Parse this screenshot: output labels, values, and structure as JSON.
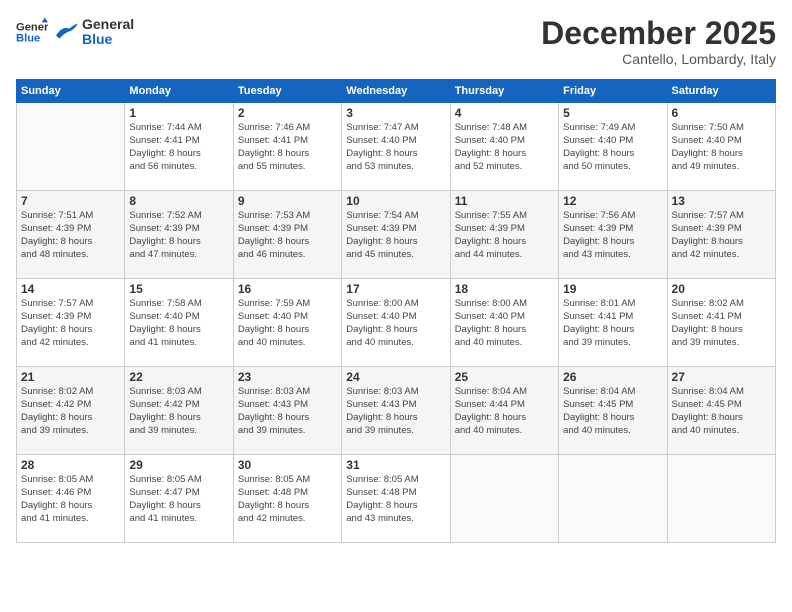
{
  "logo": {
    "general": "General",
    "blue": "Blue"
  },
  "header": {
    "month": "December 2025",
    "location": "Cantello, Lombardy, Italy"
  },
  "days_of_week": [
    "Sunday",
    "Monday",
    "Tuesday",
    "Wednesday",
    "Thursday",
    "Friday",
    "Saturday"
  ],
  "weeks": [
    [
      {
        "day": "",
        "info": ""
      },
      {
        "day": "1",
        "info": "Sunrise: 7:44 AM\nSunset: 4:41 PM\nDaylight: 8 hours\nand 56 minutes."
      },
      {
        "day": "2",
        "info": "Sunrise: 7:46 AM\nSunset: 4:41 PM\nDaylight: 8 hours\nand 55 minutes."
      },
      {
        "day": "3",
        "info": "Sunrise: 7:47 AM\nSunset: 4:40 PM\nDaylight: 8 hours\nand 53 minutes."
      },
      {
        "day": "4",
        "info": "Sunrise: 7:48 AM\nSunset: 4:40 PM\nDaylight: 8 hours\nand 52 minutes."
      },
      {
        "day": "5",
        "info": "Sunrise: 7:49 AM\nSunset: 4:40 PM\nDaylight: 8 hours\nand 50 minutes."
      },
      {
        "day": "6",
        "info": "Sunrise: 7:50 AM\nSunset: 4:40 PM\nDaylight: 8 hours\nand 49 minutes."
      }
    ],
    [
      {
        "day": "7",
        "info": "Sunrise: 7:51 AM\nSunset: 4:39 PM\nDaylight: 8 hours\nand 48 minutes."
      },
      {
        "day": "8",
        "info": "Sunrise: 7:52 AM\nSunset: 4:39 PM\nDaylight: 8 hours\nand 47 minutes."
      },
      {
        "day": "9",
        "info": "Sunrise: 7:53 AM\nSunset: 4:39 PM\nDaylight: 8 hours\nand 46 minutes."
      },
      {
        "day": "10",
        "info": "Sunrise: 7:54 AM\nSunset: 4:39 PM\nDaylight: 8 hours\nand 45 minutes."
      },
      {
        "day": "11",
        "info": "Sunrise: 7:55 AM\nSunset: 4:39 PM\nDaylight: 8 hours\nand 44 minutes."
      },
      {
        "day": "12",
        "info": "Sunrise: 7:56 AM\nSunset: 4:39 PM\nDaylight: 8 hours\nand 43 minutes."
      },
      {
        "day": "13",
        "info": "Sunrise: 7:57 AM\nSunset: 4:39 PM\nDaylight: 8 hours\nand 42 minutes."
      }
    ],
    [
      {
        "day": "14",
        "info": "Sunrise: 7:57 AM\nSunset: 4:39 PM\nDaylight: 8 hours\nand 42 minutes."
      },
      {
        "day": "15",
        "info": "Sunrise: 7:58 AM\nSunset: 4:40 PM\nDaylight: 8 hours\nand 41 minutes."
      },
      {
        "day": "16",
        "info": "Sunrise: 7:59 AM\nSunset: 4:40 PM\nDaylight: 8 hours\nand 40 minutes."
      },
      {
        "day": "17",
        "info": "Sunrise: 8:00 AM\nSunset: 4:40 PM\nDaylight: 8 hours\nand 40 minutes."
      },
      {
        "day": "18",
        "info": "Sunrise: 8:00 AM\nSunset: 4:40 PM\nDaylight: 8 hours\nand 40 minutes."
      },
      {
        "day": "19",
        "info": "Sunrise: 8:01 AM\nSunset: 4:41 PM\nDaylight: 8 hours\nand 39 minutes."
      },
      {
        "day": "20",
        "info": "Sunrise: 8:02 AM\nSunset: 4:41 PM\nDaylight: 8 hours\nand 39 minutes."
      }
    ],
    [
      {
        "day": "21",
        "info": "Sunrise: 8:02 AM\nSunset: 4:42 PM\nDaylight: 8 hours\nand 39 minutes."
      },
      {
        "day": "22",
        "info": "Sunrise: 8:03 AM\nSunset: 4:42 PM\nDaylight: 8 hours\nand 39 minutes."
      },
      {
        "day": "23",
        "info": "Sunrise: 8:03 AM\nSunset: 4:43 PM\nDaylight: 8 hours\nand 39 minutes."
      },
      {
        "day": "24",
        "info": "Sunrise: 8:03 AM\nSunset: 4:43 PM\nDaylight: 8 hours\nand 39 minutes."
      },
      {
        "day": "25",
        "info": "Sunrise: 8:04 AM\nSunset: 4:44 PM\nDaylight: 8 hours\nand 40 minutes."
      },
      {
        "day": "26",
        "info": "Sunrise: 8:04 AM\nSunset: 4:45 PM\nDaylight: 8 hours\nand 40 minutes."
      },
      {
        "day": "27",
        "info": "Sunrise: 8:04 AM\nSunset: 4:45 PM\nDaylight: 8 hours\nand 40 minutes."
      }
    ],
    [
      {
        "day": "28",
        "info": "Sunrise: 8:05 AM\nSunset: 4:46 PM\nDaylight: 8 hours\nand 41 minutes."
      },
      {
        "day": "29",
        "info": "Sunrise: 8:05 AM\nSunset: 4:47 PM\nDaylight: 8 hours\nand 41 minutes."
      },
      {
        "day": "30",
        "info": "Sunrise: 8:05 AM\nSunset: 4:48 PM\nDaylight: 8 hours\nand 42 minutes."
      },
      {
        "day": "31",
        "info": "Sunrise: 8:05 AM\nSunset: 4:48 PM\nDaylight: 8 hours\nand 43 minutes."
      },
      {
        "day": "",
        "info": ""
      },
      {
        "day": "",
        "info": ""
      },
      {
        "day": "",
        "info": ""
      }
    ]
  ]
}
